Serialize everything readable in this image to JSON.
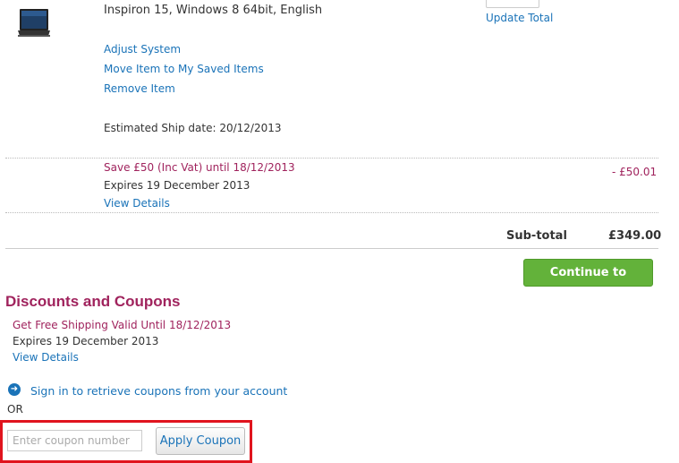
{
  "product": {
    "title": "Inspiron 15, Windows 8 64bit, English",
    "actions": [
      "Adjust System",
      "Move Item to My Saved Items",
      "Remove Item"
    ],
    "ship_date": "Estimated Ship date: 20/12/2013",
    "update_total": "Update Total"
  },
  "promo": {
    "title": "Save £50 (Inc Vat) until 18/12/2013",
    "expires": "Expires 19 December 2013",
    "details": "View Details",
    "amount": "- £50.01"
  },
  "subtotal": {
    "label": "Sub-total",
    "value": "£349.00"
  },
  "checkout_button": "Continue to checkout",
  "discounts": {
    "title": "Discounts and Coupons",
    "offer_title": "Get Free Shipping Valid Until 18/12/2013",
    "offer_expires": "Expires 19 December 2013",
    "offer_details": "View Details",
    "signin": "Sign in to retrieve coupons from your account",
    "or": "OR",
    "coupon_placeholder": "Enter coupon number",
    "apply_button": "Apply Coupon"
  },
  "colors": {
    "link": "#1a73b8",
    "promo": "#a0235d",
    "checkout_green": "#63b23a",
    "highlight_red": "#e0141e"
  }
}
